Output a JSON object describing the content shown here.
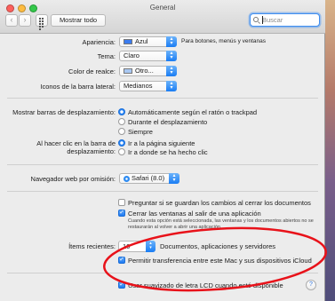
{
  "window": {
    "title": "General"
  },
  "toolbar": {
    "show_all_label": "Mostrar todo",
    "search_placeholder": "Buscar"
  },
  "appearance": {
    "label": "Apariencia:",
    "value": "Azul",
    "swatch_color": "#3b7cf0",
    "note": "Para botones, menús y ventanas",
    "dark_menu_label": "Tema:",
    "dark_menu_value": "Claro"
  },
  "highlight": {
    "label": "Color de realce:",
    "value": "Otro...",
    "swatch_color": "#a9c8f2"
  },
  "sidebar_icon": {
    "label": "Iconos de la barra lateral:",
    "value": "Medianos"
  },
  "scrollbars": {
    "label": "Mostrar barras de desplazamiento:",
    "options": [
      "Automáticamente según el ratón o trackpad",
      "Durante el desplazamiento",
      "Siempre"
    ]
  },
  "click_scroll": {
    "label_line1": "Al hacer clic en la barra de",
    "label_line2": "desplazamiento:",
    "options": [
      "Ir a la página siguiente",
      "Ir a donde se ha hecho clic"
    ]
  },
  "browser": {
    "label": "Navegador web por omisión:",
    "value": "Safari (8.0)"
  },
  "documents": {
    "ask_save": "Preguntar si se guardan los cambios al cerrar los documentos",
    "close_windows": "Cerrar las ventanas al salir de una aplicación",
    "close_desc": "Cuando esta opción está seleccionada, las ventanas y los documentos abiertos no se restaurarán al volver a abrir una aplicación."
  },
  "recent": {
    "label": "Ítems recientes:",
    "value": "10",
    "suffix": "Documentos, aplicaciones y servidores"
  },
  "handoff": {
    "label": "Permitir transferencia entre este Mac y sus dispositivos iCloud"
  },
  "lcd": {
    "label": "Usar suavizado de letra LCD cuando esté disponible"
  },
  "help": {
    "glyph": "?"
  },
  "annotation": {
    "color": "#e8121a"
  }
}
